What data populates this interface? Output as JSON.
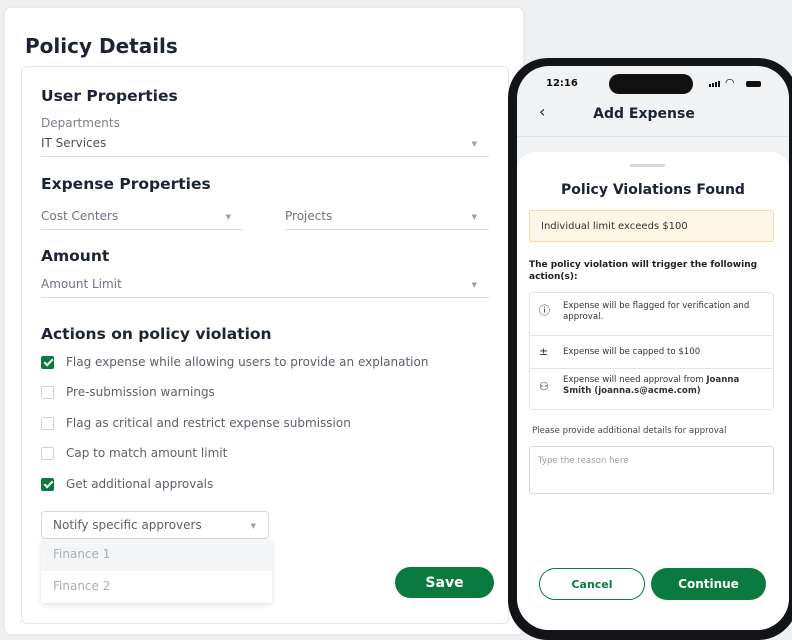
{
  "policy": {
    "title": "Policy Details",
    "user_properties": {
      "heading": "User Properties",
      "departments_label": "Departments",
      "departments_value": "IT Services"
    },
    "expense_properties": {
      "heading": "Expense Properties",
      "cost_centers_placeholder": "Cost Centers",
      "projects_placeholder": "Projects"
    },
    "amount": {
      "heading": "Amount",
      "limit_placeholder": "Amount Limit"
    },
    "actions": {
      "heading": "Actions on policy violation",
      "options": [
        {
          "label": "Flag expense while allowing users to provide an explanation",
          "checked": true
        },
        {
          "label": "Pre-submission warnings",
          "checked": false
        },
        {
          "label": "Flag as critical and restrict expense submission",
          "checked": false
        },
        {
          "label": "Cap to match amount limit",
          "checked": false
        },
        {
          "label": "Get additional approvals",
          "checked": true
        }
      ]
    },
    "approvers": {
      "placeholder": "Notify specific approvers",
      "options": [
        "Finance 1",
        "Finance 2"
      ]
    },
    "save_label": "Save"
  },
  "phone": {
    "status_time": "12:16",
    "back_glyph": "‹",
    "title": "Add Expense",
    "sheet": {
      "title": "Policy Violations Found",
      "alert": "Individual limit exceeds $100",
      "trigger_text": "The policy violation will trigger the following action(s):",
      "actions": [
        {
          "icon": "alert-circle-icon",
          "glyph": "ⓘ",
          "text": "Expense will be flagged for verification and approval."
        },
        {
          "icon": "plus-minus-icon",
          "glyph": "±",
          "text": "Expense will be capped to $100"
        },
        {
          "icon": "users-icon",
          "glyph": "⚇",
          "text_prefix": "Expense will need approval from ",
          "text_bold": "Joanna Smith (joanna.s@acme.com)"
        }
      ],
      "details_label": "Please provide additional details for approval",
      "reason_placeholder": "Type the reason here",
      "cancel_label": "Cancel",
      "continue_label": "Continue"
    }
  },
  "colors": {
    "brand_green": "#0b7a3e",
    "alert_bg": "#fdf5e5"
  }
}
